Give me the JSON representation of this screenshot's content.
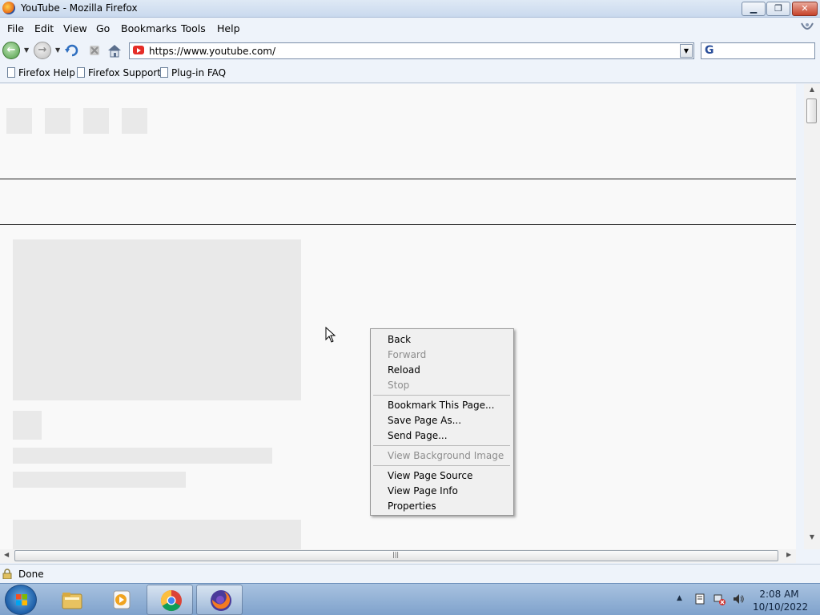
{
  "window": {
    "title": "YouTube - Mozilla Firefox"
  },
  "menubar": {
    "items": [
      "File",
      "Edit",
      "View",
      "Go",
      "Bookmarks",
      "Tools",
      "Help"
    ]
  },
  "navbar": {
    "url": "https://www.youtube.com/",
    "search_placeholder": "",
    "icons": [
      "back-icon",
      "forward-icon",
      "reload-icon",
      "stop-icon",
      "home-icon"
    ]
  },
  "bookmarks": {
    "items": [
      "Firefox Help",
      "Firefox Support",
      "Plug-in FAQ"
    ]
  },
  "status": {
    "text": "Done"
  },
  "context_menu": {
    "items": [
      {
        "label": "Back",
        "enabled": true
      },
      {
        "label": "Forward",
        "enabled": false
      },
      {
        "label": "Reload",
        "enabled": true
      },
      {
        "label": "Stop",
        "enabled": false
      },
      {
        "label": "Bookmark This Page...",
        "enabled": true
      },
      {
        "label": "Save Page As...",
        "enabled": true
      },
      {
        "label": "Send Page...",
        "enabled": true
      },
      {
        "label": "View Background Image",
        "enabled": false
      },
      {
        "label": "View Page Source",
        "enabled": true
      },
      {
        "label": "View Page Info",
        "enabled": true
      },
      {
        "label": "Properties",
        "enabled": true
      }
    ]
  },
  "taskbar": {
    "apps": [
      "file-explorer-icon",
      "media-player-icon",
      "chrome-icon",
      "firefox-icon"
    ],
    "clock_time": "2:08 AM",
    "clock_date": "10/10/2022"
  },
  "colors": {
    "accent": "#1d5da7",
    "youtube_red": "#e52d27",
    "skeleton": "#e9e9e9"
  }
}
